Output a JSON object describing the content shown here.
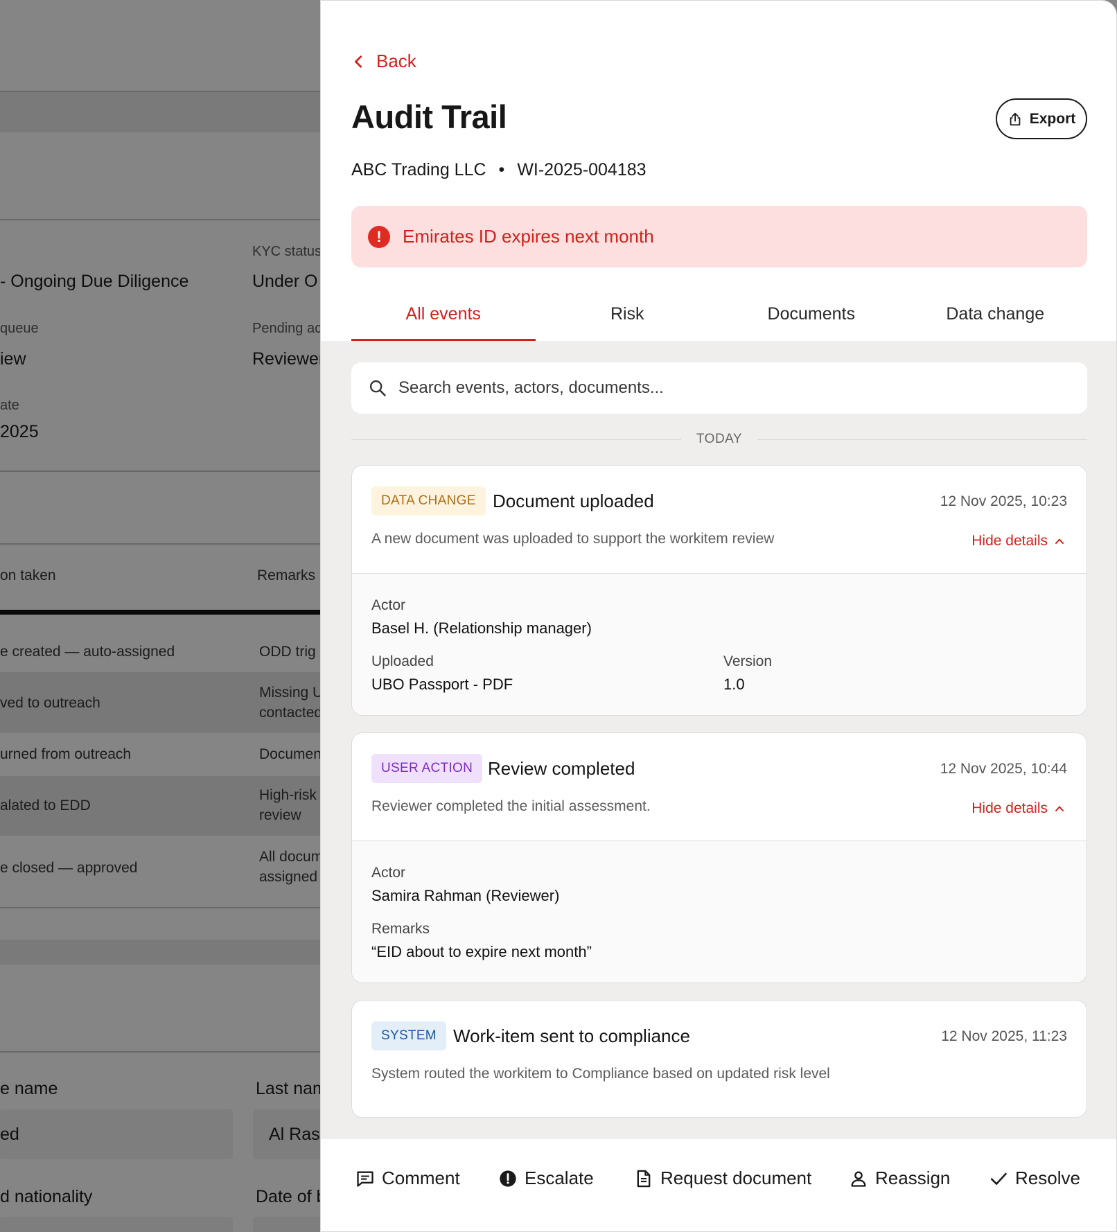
{
  "background": {
    "kyc_label": "KYC status",
    "kyc_value": "Under O",
    "type_value": "- Ongoing Due Diligence",
    "queue_label": "queue",
    "queue_value": "iew",
    "pending_label": "Pending ac",
    "pending_value": "Reviewer",
    "date_label": "ate",
    "date_value": "2025",
    "col_action": "on taken",
    "col_remarks": "Remarks",
    "rows": [
      {
        "action": "e created — auto-assigned",
        "remarks": "ODD trig"
      },
      {
        "action": "ved to outreach",
        "remarks": "Missing U\ncontacted"
      },
      {
        "action": "urned from outreach",
        "remarks": "Documen"
      },
      {
        "action": "alated to EDD",
        "remarks": "High-risk\nreview"
      },
      {
        "action": "e closed — approved",
        "remarks": "All docum\nassigned"
      }
    ],
    "first_name_label": "e name",
    "first_name_value": "ed",
    "last_name_label": "Last nam",
    "last_name_value": "Al Rash",
    "nationality_label": "d nationality",
    "dob_label": "Date of b"
  },
  "panel": {
    "back_label": "Back",
    "title": "Audit Trail",
    "export_label": "Export",
    "company": "ABC Trading LLC",
    "separator": "•",
    "workitem_id": "WI-2025-004183",
    "alert_text": "Emirates ID expires next month",
    "tabs": [
      {
        "label": "All events",
        "active": true
      },
      {
        "label": "Risk",
        "active": false
      },
      {
        "label": "Documents",
        "active": false
      },
      {
        "label": "Data change",
        "active": false
      }
    ],
    "search_placeholder": "Search events, actors, documents...",
    "day_label": "TODAY",
    "events": [
      {
        "badge": "DATA CHANGE",
        "title": "Document uploaded",
        "time": "12 Nov 2025, 10:23",
        "description": "A new document was uploaded to support the workitem review",
        "toggle": "Hide details",
        "actor_label": "Actor",
        "actor": "Basel H. (Relationship manager)",
        "uploaded_label": "Uploaded",
        "uploaded": "UBO Passport - PDF",
        "version_label": "Version",
        "version": "1.0"
      },
      {
        "badge": "USER ACTION",
        "title": "Review completed",
        "time": "12 Nov 2025, 10:44",
        "description": "Reviewer completed the initial assessment.",
        "toggle": "Hide details",
        "actor_label": "Actor",
        "actor": "Samira Rahman (Reviewer)",
        "remarks_label": "Remarks",
        "remarks": "“EID about to expire next month”"
      },
      {
        "badge": "SYSTEM",
        "title": "Work-item sent to compliance",
        "time": "12 Nov 2025, 11:23",
        "description": "System routed the workitem to Compliance based on updated risk level"
      }
    ],
    "actions": {
      "comment": "Comment",
      "escalate": "Escalate",
      "request_document": "Request document",
      "reassign": "Reassign",
      "resolve": "Resolve"
    }
  },
  "colors": {
    "accent": "#d2211b",
    "alert_bg": "#fddfe0",
    "data_change_badge": "#fdf3de",
    "user_action_badge": "#efe1fb",
    "system_badge": "#e4eef9"
  },
  "icons": {
    "back": "chevron-left-icon",
    "export": "share-icon",
    "alert": "error-circle-icon",
    "search": "search-icon",
    "toggle": "chevron-up-icon",
    "comment": "comment-icon",
    "escalate": "exclamation-circle-icon",
    "request_document": "document-icon",
    "reassign": "person-icon",
    "resolve": "check-icon"
  }
}
